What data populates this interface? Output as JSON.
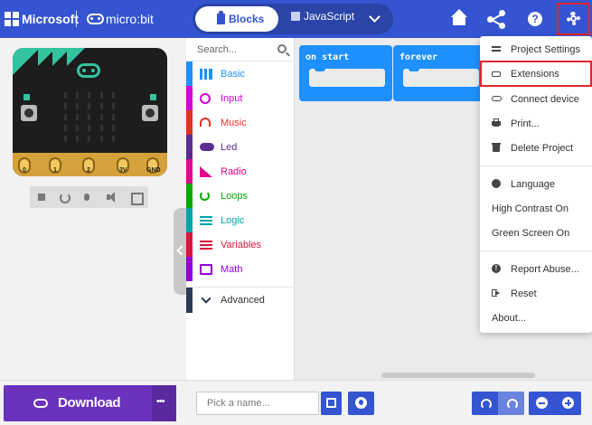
{
  "header": {
    "brand": "Microsoft",
    "product": "micro:bit",
    "tabs": [
      {
        "label": "Blocks",
        "active": true
      },
      {
        "label": "JavaScript",
        "active": false
      }
    ],
    "icons": [
      "home-icon",
      "share-icon",
      "help-icon",
      "gear-icon"
    ]
  },
  "simulator": {
    "pins": [
      "0",
      "1",
      "2",
      "3V",
      "GND"
    ],
    "buttons": [
      "stop-icon",
      "restart-icon",
      "debug-icon",
      "sound-icon",
      "fullscreen-icon"
    ]
  },
  "toolbox": {
    "search_placeholder": "Search...",
    "categories": [
      {
        "label": "Basic",
        "color": "#1e90ff"
      },
      {
        "label": "Input",
        "color": "#d400d4"
      },
      {
        "label": "Music",
        "color": "#e63022"
      },
      {
        "label": "Led",
        "color": "#5c2d91"
      },
      {
        "label": "Radio",
        "color": "#e3008c"
      },
      {
        "label": "Loops",
        "color": "#00aa00"
      },
      {
        "label": "Logic",
        "color": "#00a4a6"
      },
      {
        "label": "Variables",
        "color": "#dc143c"
      },
      {
        "label": "Math",
        "color": "#9400d3"
      }
    ],
    "advanced_label": "Advanced"
  },
  "workspace": {
    "blocks": [
      {
        "label": "on start",
        "color": "#1e90ff"
      },
      {
        "label": "forever",
        "color": "#1e90ff"
      }
    ]
  },
  "settings_menu": {
    "groups": [
      [
        {
          "label": "Project Settings",
          "icon": "adjust-icon"
        },
        {
          "label": "Extensions",
          "icon": "drive-icon",
          "highlighted": true
        },
        {
          "label": "Connect device",
          "icon": "link-icon"
        },
        {
          "label": "Print...",
          "icon": "print-icon"
        },
        {
          "label": "Delete Project",
          "icon": "trash-icon"
        }
      ],
      [
        {
          "label": "Language",
          "icon": "globe-icon"
        },
        {
          "label": "High Contrast On"
        },
        {
          "label": "Green Screen On"
        }
      ],
      [
        {
          "label": "Report Abuse...",
          "icon": "warning-icon"
        },
        {
          "label": "Reset",
          "icon": "sign-out-icon"
        },
        {
          "label": "About..."
        }
      ]
    ]
  },
  "bottom": {
    "download_label": "Download",
    "project_name_placeholder": "Pick a name...",
    "project_name_value": ""
  },
  "colors": {
    "header": "#3454d1",
    "download": "#6b32bd",
    "highlight": "#e0262b",
    "board_accent": "#33c49f"
  }
}
